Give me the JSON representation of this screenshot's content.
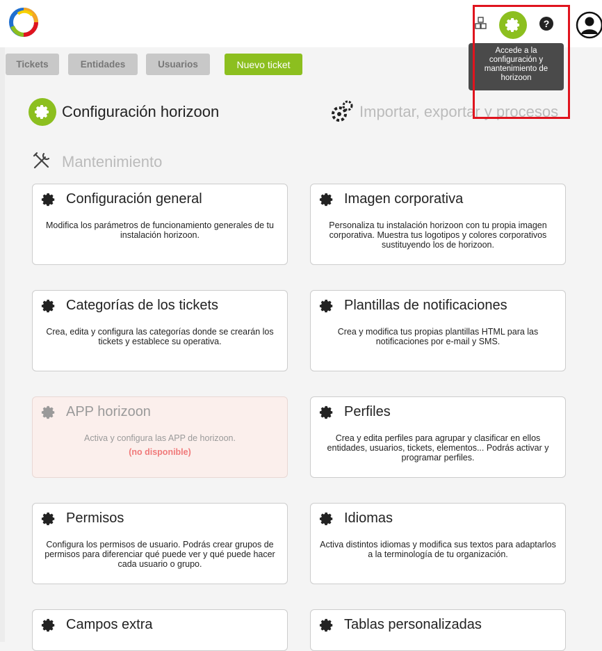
{
  "tooltip": {
    "text_line1": "Accede a la",
    "text_line2": "configuración y",
    "text_line3": "mantenimiento de",
    "text_line4": "horizoon"
  },
  "nav": {
    "tickets": "Tickets",
    "entidades": "Entidades",
    "usuarios": "Usuarios",
    "nuevo_ticket": "Nuevo ticket"
  },
  "sections": {
    "config": "Configuración horizoon",
    "import": "Importar, exportar y procesos",
    "maintenance": "Mantenimiento"
  },
  "cards": [
    {
      "title": "Configuración general",
      "desc": "Modifica los parámetros de funcionamiento generales de tu instalación horizoon."
    },
    {
      "title": "Imagen corporativa",
      "desc": "Personaliza tu instalación horizoon con tu propia imagen corporativa. Muestra tus logotipos y colores corporativos sustituyendo los de horizoon."
    },
    {
      "title": "Categorías de los tickets",
      "desc": "Crea, edita y configura las categorías donde se crearán los tickets y establece su operativa."
    },
    {
      "title": "Plantillas de notificaciones",
      "desc": "Crea y modifica tus propias plantillas HTML para las notificaciones por e-mail y SMS."
    },
    {
      "title": "APP horizoon",
      "desc": "Activa y configura las APP de horizoon.",
      "status": "(no disponible)"
    },
    {
      "title": "Perfiles",
      "desc": "Crea y edita perfiles para agrupar y clasificar en ellos entidades, usuarios, tickets, elementos... Podrás activar y programar perfiles."
    },
    {
      "title": "Permisos",
      "desc": "Configura los permisos de usuario. Podrás crear grupos de permisos para diferenciar qué puede ver y qué puede hacer cada usuario o grupo."
    },
    {
      "title": "Idiomas",
      "desc": "Activa distintos idiomas y modifica sus textos para adaptarlos a la terminología de tu organización."
    },
    {
      "title": "Campos extra",
      "desc": ""
    },
    {
      "title": "Tablas personalizadas",
      "desc": ""
    }
  ],
  "colors": {
    "accent": "#8cbf1f",
    "highlight": "#e0141e",
    "tooltip_bg": "#4a4a4a",
    "unavailable": "#f07a7a"
  }
}
